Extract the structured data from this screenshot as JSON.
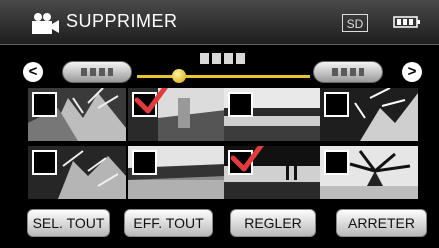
{
  "header": {
    "title": "SUPPRIMER",
    "media": "SD",
    "mode_icon": "video-camera-icon",
    "battery_icon": "battery-icon"
  },
  "nav": {
    "prev_symbol": "<",
    "next_symbol": ">",
    "page_position": 0.25
  },
  "thumbnails": [
    {
      "checked": false
    },
    {
      "checked": true
    },
    {
      "checked": false
    },
    {
      "checked": false
    },
    {
      "checked": false
    },
    {
      "checked": false
    },
    {
      "checked": true
    },
    {
      "checked": false
    }
  ],
  "buttons": {
    "select_all": "SEL. TOUT",
    "clear_all": "EFF. TOUT",
    "set": "REGLER",
    "stop": "ARRETER"
  },
  "colors": {
    "accent": "#e7c531",
    "check": "#e23b3b"
  }
}
